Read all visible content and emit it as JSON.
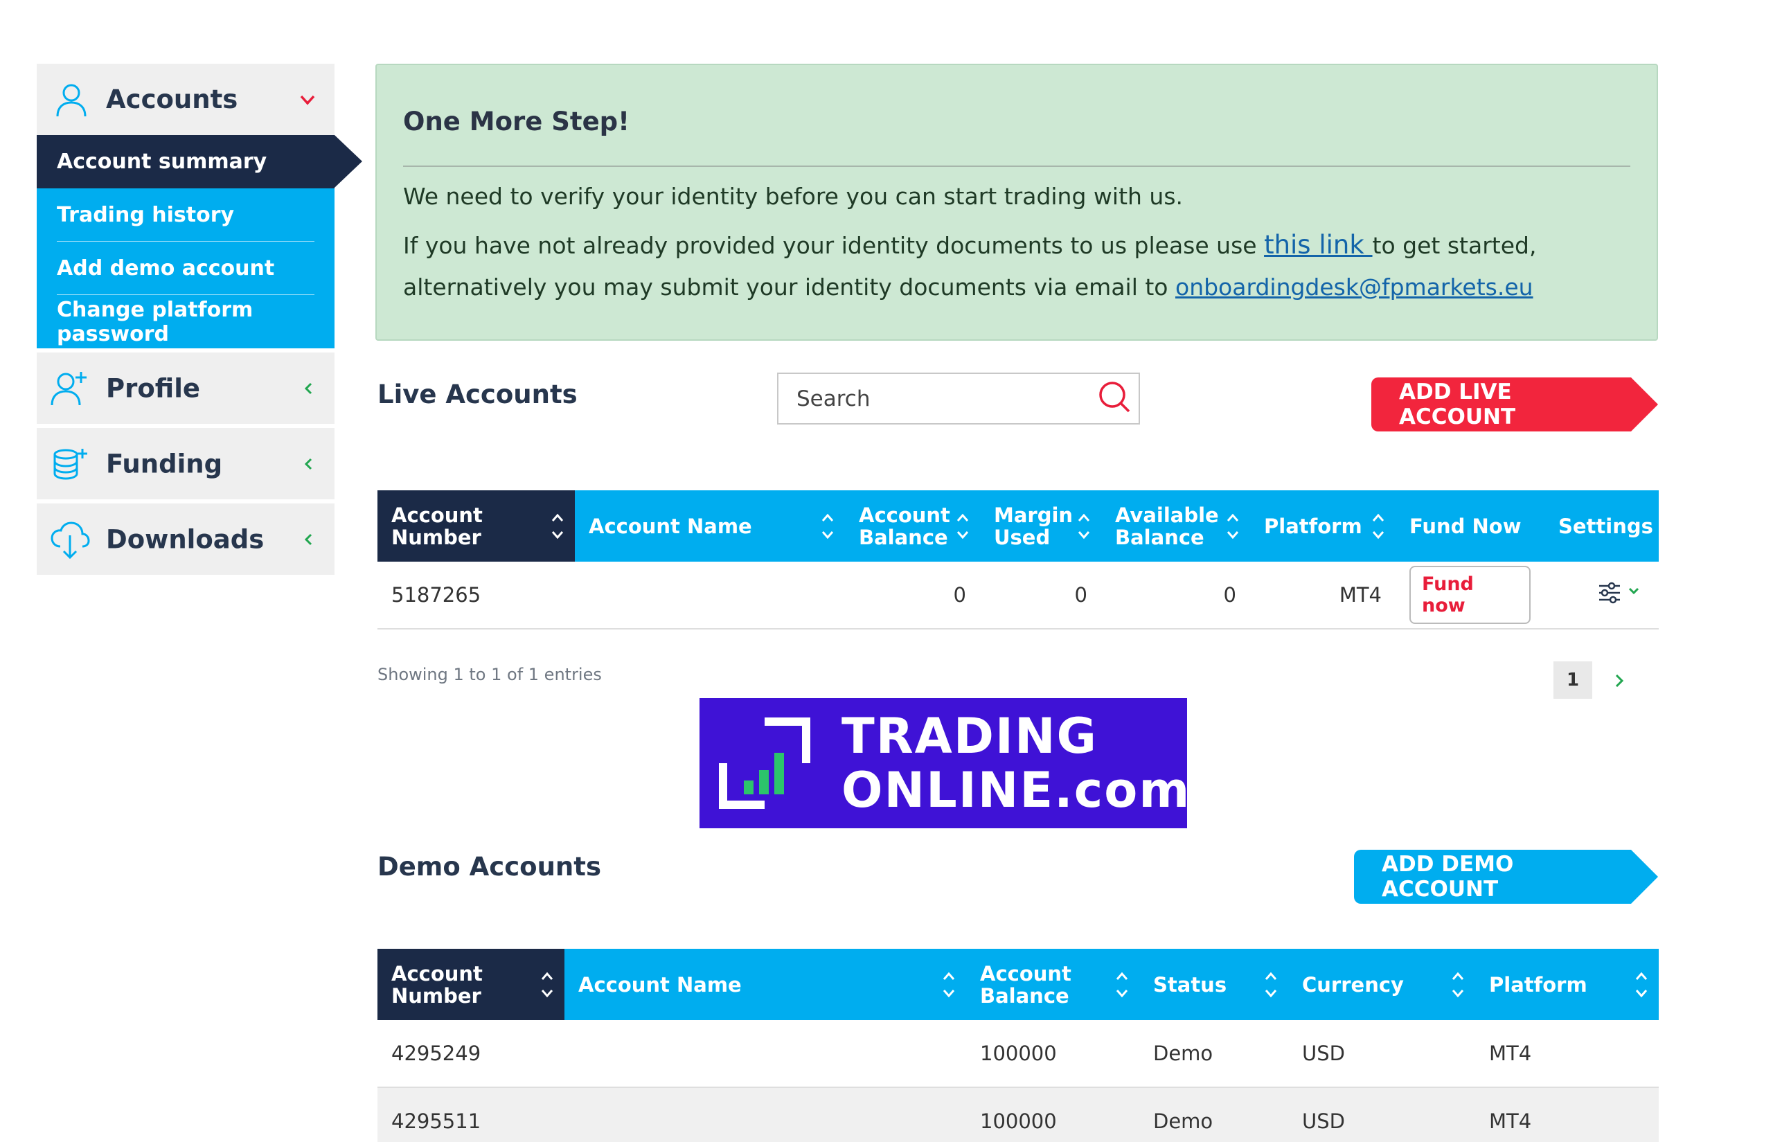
{
  "sidebar": {
    "accounts_label": "Accounts",
    "submenu": [
      "Account summary",
      "Trading history",
      "Add demo account",
      "Change platform password"
    ],
    "sections": [
      "Profile",
      "Funding",
      "Downloads"
    ]
  },
  "alert": {
    "title": "One More Step!",
    "line1": "We need to verify your identity before you can start trading with us.",
    "line2_before": "If you have not already provided your identity documents to us please use ",
    "line2_link": "this link ",
    "line2_after": "to get started, alternatively you may submit your identity documents via email to ",
    "email": "onboardingdesk@fpmarkets.eu"
  },
  "live": {
    "title": "Live Accounts",
    "search_placeholder": "Search",
    "add_label": "ADD LIVE ACCOUNT",
    "headers": {
      "account_number": "Account Number",
      "account_name": "Account Name",
      "account_balance": "Account Balance",
      "margin_used": "Margin Used",
      "available_balance": "Available Balance",
      "platform": "Platform",
      "fund_now": "Fund Now",
      "settings": "Settings"
    },
    "rows": [
      {
        "number": "5187265",
        "name": "",
        "balance": "0",
        "margin": "0",
        "available": "0",
        "platform": "MT4",
        "fund_label": "Fund now"
      }
    ],
    "showing": "Showing 1 to 1 of 1 entries",
    "page": "1"
  },
  "banner": {
    "line1": "TRADING",
    "line2": "ONLINE.com"
  },
  "demo": {
    "title": "Demo Accounts",
    "add_label": "ADD DEMO ACCOUNT",
    "headers": {
      "account_number": "Account Number",
      "account_name": "Account Name",
      "account_balance": "Account Balance",
      "status": "Status",
      "currency": "Currency",
      "platform": "Platform"
    },
    "rows": [
      {
        "number": "4295249",
        "name": "",
        "balance": "100000",
        "status": "Demo",
        "currency": "USD",
        "platform": "MT4"
      },
      {
        "number": "4295511",
        "name": "",
        "balance": "100000",
        "status": "Demo",
        "currency": "USD",
        "platform": "MT4"
      }
    ]
  },
  "colors": {
    "primary_blue": "#00adef",
    "navy": "#1b2a47",
    "cta_red": "#f2253d",
    "alert_green": "#cde8d3",
    "banner_purple": "#3f12d6"
  }
}
